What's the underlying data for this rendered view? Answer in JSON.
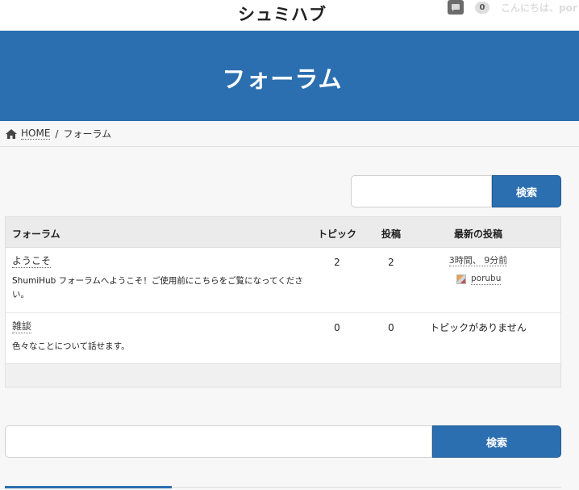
{
  "header": {
    "site_title": "シュミハブ",
    "comment_count": "0",
    "greeting": "こんにちは、por"
  },
  "banner": {
    "title": "フォーラム"
  },
  "breadcrumb": {
    "home": "HOME",
    "separator": "/",
    "current": "フォーラム"
  },
  "search": {
    "button_label": "検索",
    "placeholder": ""
  },
  "table": {
    "headers": {
      "forum": "フォーラム",
      "topics": "トピック",
      "posts": "投稿",
      "latest": "最新の投稿"
    },
    "rows": [
      {
        "name": "ようこそ",
        "description": "ShumiHub フォーラムへようこそ！ご使用前にこちらをご覧になってください。",
        "topics": "2",
        "posts": "2",
        "latest_time": "3時間、 9分前",
        "latest_author": "porubu"
      },
      {
        "name": "雑談",
        "description": "色々なことについて話せます。",
        "topics": "0",
        "posts": "0",
        "no_topics": "トピックがありません"
      }
    ]
  },
  "colors": {
    "accent": "#2b6fb1",
    "background": "#f7f7f7"
  }
}
